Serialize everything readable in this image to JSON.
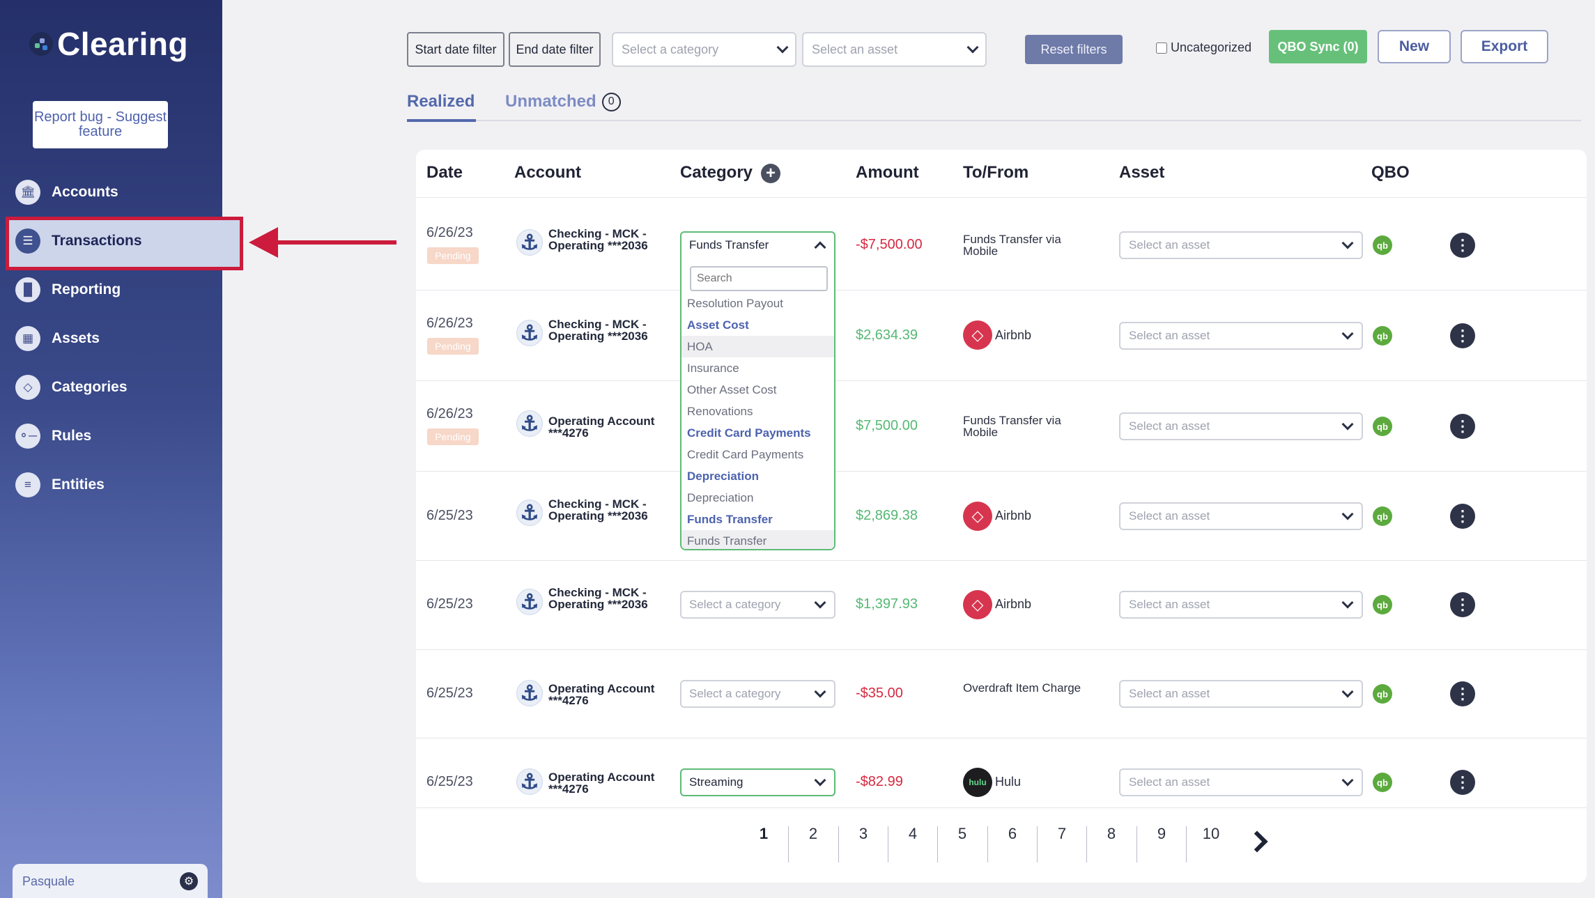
{
  "app": {
    "name": "Clearing"
  },
  "sidebar": {
    "report_button": "Report bug - Suggest feature",
    "items": [
      {
        "label": "Accounts",
        "icon": "bank-icon"
      },
      {
        "label": "Transactions",
        "icon": "document-icon"
      },
      {
        "label": "Reporting",
        "icon": "bar-chart-icon"
      },
      {
        "label": "Assets",
        "icon": "building-icon"
      },
      {
        "label": "Categories",
        "icon": "tag-icon"
      },
      {
        "label": "Rules",
        "icon": "toggle-icon"
      },
      {
        "label": "Entities",
        "icon": "list-icon"
      }
    ],
    "active_item": "Transactions",
    "user": "Pasquale"
  },
  "filters": {
    "start_date": "Start date filter",
    "end_date": "End date filter",
    "category_placeholder": "Select a category",
    "asset_placeholder": "Select an asset",
    "reset": "Reset filters",
    "uncategorized": "Uncategorized",
    "qbo_sync": "QBO Sync (0)",
    "new": "New",
    "export": "Export"
  },
  "tabs": {
    "realized": "Realized",
    "unmatched": "Unmatched",
    "unmatched_count": "0"
  },
  "table": {
    "headers": {
      "date": "Date",
      "account": "Account",
      "category": "Category",
      "amount": "Amount",
      "to_from": "To/From",
      "asset": "Asset",
      "qbo": "QBO"
    },
    "pending_label": "Pending",
    "asset_placeholder": "Select an asset",
    "category_placeholder": "Select a category",
    "rows": [
      {
        "date": "6/26/23",
        "pending": true,
        "account": "Checking - MCK - Operating ***2036",
        "category": "Funds Transfer",
        "amount": "-$7,500.00",
        "to_from": "Funds Transfer via Mobile"
      },
      {
        "date": "6/26/23",
        "pending": true,
        "account": "Checking - MCK - Operating ***2036",
        "category": "",
        "amount": "$2,634.39",
        "to_from": "Airbnb"
      },
      {
        "date": "6/26/23",
        "pending": true,
        "account": "Operating Account ***4276",
        "category": "",
        "amount": "$7,500.00",
        "to_from": "Funds Transfer via Mobile"
      },
      {
        "date": "6/25/23",
        "pending": false,
        "account": "Checking - MCK - Operating ***2036",
        "category": "",
        "amount": "$2,869.38",
        "to_from": "Airbnb"
      },
      {
        "date": "6/25/23",
        "pending": false,
        "account": "Checking - MCK - Operating ***2036",
        "category": "Select a category",
        "amount": "$1,397.93",
        "to_from": "Airbnb"
      },
      {
        "date": "6/25/23",
        "pending": false,
        "account": "Operating Account ***4276",
        "category": "Select a category",
        "amount": "-$35.00",
        "to_from": "Overdraft Item Charge"
      },
      {
        "date": "6/25/23",
        "pending": false,
        "account": "Operating Account ***4276",
        "category": "Streaming",
        "amount": "-$82.99",
        "to_from": "Hulu"
      }
    ]
  },
  "category_dropdown": {
    "search_placeholder": "Search",
    "items": [
      {
        "label": "Resolution Payout",
        "group": false
      },
      {
        "label": "Asset Cost",
        "group": true
      },
      {
        "label": "HOA",
        "group": false
      },
      {
        "label": "Insurance",
        "group": false
      },
      {
        "label": "Other Asset Cost",
        "group": false
      },
      {
        "label": "Renovations",
        "group": false
      },
      {
        "label": "Credit Card Payments",
        "group": true
      },
      {
        "label": "Credit Card Payments",
        "group": false
      },
      {
        "label": "Depreciation",
        "group": true
      },
      {
        "label": "Depreciation",
        "group": false
      },
      {
        "label": "Funds Transfer",
        "group": true
      },
      {
        "label": "Funds Transfer",
        "group": false
      }
    ]
  },
  "logos": {
    "hulu": "hulu",
    "qbo": "qb"
  },
  "pagination": {
    "pages": [
      "1",
      "2",
      "3",
      "4",
      "5",
      "6",
      "7",
      "8",
      "9",
      "10"
    ],
    "current": "1"
  },
  "colors": {
    "sidebar_top": "#25306a",
    "accent": "#5468ad",
    "negative": "#d6283f",
    "positive": "#55b873",
    "qbo_green": "#67c07a",
    "highlight_red": "#cc1b3c"
  }
}
